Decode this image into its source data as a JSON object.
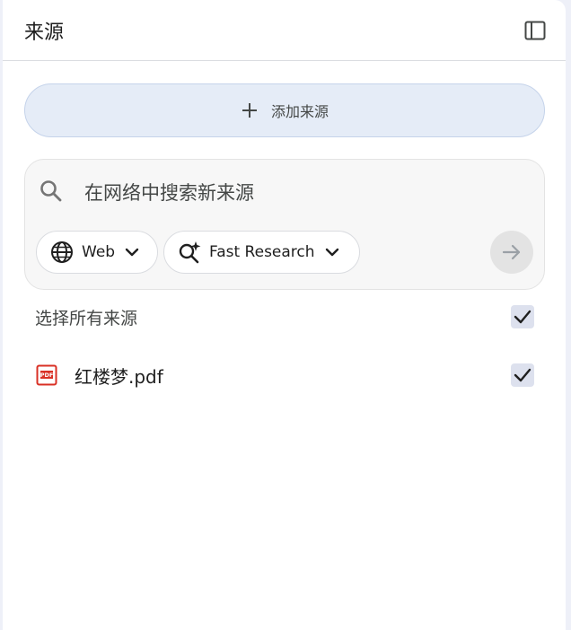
{
  "header": {
    "title": "来源",
    "toggle_icon": "sidebar-panel-icon"
  },
  "add_source": {
    "label": "添加来源",
    "icon": "plus-icon"
  },
  "search": {
    "placeholder": "在网络中搜索新来源",
    "value": "",
    "icon": "search-icon",
    "source_chip": {
      "label": "Web",
      "icon": "globe-icon"
    },
    "mode_chip": {
      "label": "Fast Research",
      "icon": "sparkle-search-icon"
    },
    "submit_icon": "arrow-right-icon"
  },
  "select_all": {
    "label": "选择所有来源",
    "checked": true
  },
  "sources": [
    {
      "name": "红楼梦.pdf",
      "type_icon": "pdf-icon",
      "checked": true
    }
  ],
  "colors": {
    "add_button_bg": "#e5ecf7",
    "search_bg": "#f7f7f7",
    "pdf_red": "#d93025",
    "checkbox_bg": "#dde1ee"
  }
}
